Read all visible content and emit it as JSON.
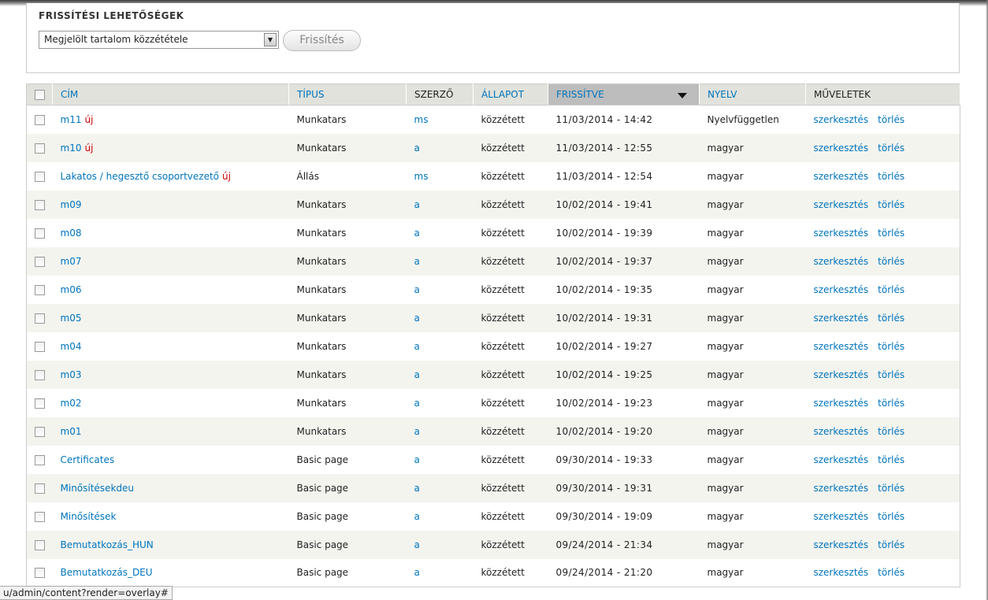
{
  "update_options": {
    "title": "Frissítési lehetőségek",
    "select_value": "Megjelölt tartalom közzététele",
    "button_label": "Frissítés"
  },
  "table": {
    "columns": {
      "title": "CÍM",
      "type": "TÍPUS",
      "author": "SZERZŐ",
      "status": "ÁLLAPOT",
      "updated": "FRISSÍTVE",
      "language": "NYELV",
      "operations": "MŰVELETEK"
    },
    "new_label": "új",
    "edit_label": "szerkesztés",
    "delete_label": "törlés",
    "rows": [
      {
        "title": "m11",
        "is_new": true,
        "type": "Munkatars",
        "author": "ms",
        "status": "közzétett",
        "updated": "11/03/2014 - 14:42",
        "language": "Nyelvfüggetlen"
      },
      {
        "title": "m10",
        "is_new": true,
        "type": "Munkatars",
        "author": "a",
        "status": "közzétett",
        "updated": "11/03/2014 - 12:55",
        "language": "magyar"
      },
      {
        "title": "Lakatos / hegesztő csoportvezető",
        "is_new": true,
        "type": "Állás",
        "author": "ms",
        "status": "közzétett",
        "updated": "11/03/2014 - 12:54",
        "language": "magyar"
      },
      {
        "title": "m09",
        "is_new": false,
        "type": "Munkatars",
        "author": "a",
        "status": "közzétett",
        "updated": "10/02/2014 - 19:41",
        "language": "magyar"
      },
      {
        "title": "m08",
        "is_new": false,
        "type": "Munkatars",
        "author": "a",
        "status": "közzétett",
        "updated": "10/02/2014 - 19:39",
        "language": "magyar"
      },
      {
        "title": "m07",
        "is_new": false,
        "type": "Munkatars",
        "author": "a",
        "status": "közzétett",
        "updated": "10/02/2014 - 19:37",
        "language": "magyar"
      },
      {
        "title": "m06",
        "is_new": false,
        "type": "Munkatars",
        "author": "a",
        "status": "közzétett",
        "updated": "10/02/2014 - 19:35",
        "language": "magyar"
      },
      {
        "title": "m05",
        "is_new": false,
        "type": "Munkatars",
        "author": "a",
        "status": "közzétett",
        "updated": "10/02/2014 - 19:31",
        "language": "magyar"
      },
      {
        "title": "m04",
        "is_new": false,
        "type": "Munkatars",
        "author": "a",
        "status": "közzétett",
        "updated": "10/02/2014 - 19:27",
        "language": "magyar"
      },
      {
        "title": "m03",
        "is_new": false,
        "type": "Munkatars",
        "author": "a",
        "status": "közzétett",
        "updated": "10/02/2014 - 19:25",
        "language": "magyar"
      },
      {
        "title": "m02",
        "is_new": false,
        "type": "Munkatars",
        "author": "a",
        "status": "közzétett",
        "updated": "10/02/2014 - 19:23",
        "language": "magyar"
      },
      {
        "title": "m01",
        "is_new": false,
        "type": "Munkatars",
        "author": "a",
        "status": "közzétett",
        "updated": "10/02/2014 - 19:20",
        "language": "magyar"
      },
      {
        "title": "Certificates",
        "is_new": false,
        "type": "Basic page",
        "author": "a",
        "status": "közzétett",
        "updated": "09/30/2014 - 19:33",
        "language": "magyar"
      },
      {
        "title": "Minősítésekdeu",
        "is_new": false,
        "type": "Basic page",
        "author": "a",
        "status": "közzétett",
        "updated": "09/30/2014 - 19:31",
        "language": "magyar"
      },
      {
        "title": "Minősítések",
        "is_new": false,
        "type": "Basic page",
        "author": "a",
        "status": "közzétett",
        "updated": "09/30/2014 - 19:09",
        "language": "magyar"
      },
      {
        "title": "Bemutatkozás_HUN",
        "is_new": false,
        "type": "Basic page",
        "author": "a",
        "status": "közzétett",
        "updated": "09/24/2014 - 21:34",
        "language": "magyar"
      },
      {
        "title": "Bemutatkozás_DEU",
        "is_new": false,
        "type": "Basic page",
        "author": "a",
        "status": "közzétett",
        "updated": "09/24/2014 - 21:20",
        "language": "magyar"
      }
    ]
  },
  "status_bar": {
    "url": "u/admin/content?render=overlay#"
  }
}
